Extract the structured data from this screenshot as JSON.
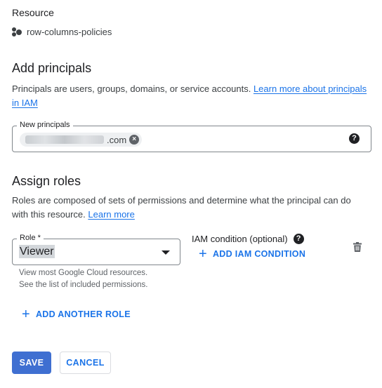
{
  "resource": {
    "label": "Resource",
    "name": "row-columns-policies",
    "icon": "resource-dots-icon"
  },
  "add_principals": {
    "title": "Add principals",
    "desc_text": "Principals are users, groups, domains, or service accounts.",
    "learn_more_link": "Learn more about principals in IAM",
    "field_label": "New principals",
    "chip_suffix": ".com",
    "help_icon": "help-circle-icon"
  },
  "assign_roles": {
    "title": "Assign roles",
    "desc_text": "Roles are composed of sets of permissions and determine what the principal can do with this resource.",
    "learn_more_link": "Learn more",
    "role_label": "Role *",
    "role_value": "Viewer",
    "role_hint_line1": "View most Google Cloud resources.",
    "role_hint_line2": "See the list of included permissions.",
    "iam_condition_label": "IAM condition (optional)",
    "add_iam_condition": "ADD IAM CONDITION",
    "add_another_role": "ADD ANOTHER ROLE"
  },
  "actions": {
    "save": "SAVE",
    "cancel": "CANCEL"
  },
  "colors": {
    "primary": "#1a73e8",
    "save_button": "#3f6fd1",
    "text": "#202124"
  }
}
